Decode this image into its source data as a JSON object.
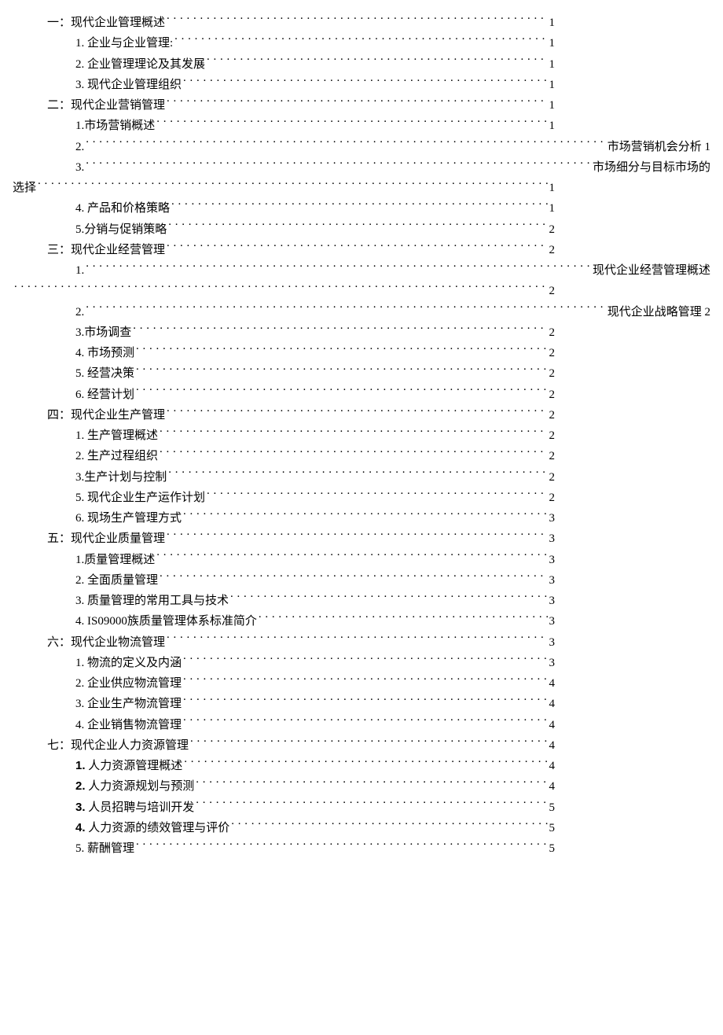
{
  "toc": [
    {
      "level": 0,
      "label": "一：现代企业管理概述",
      "page": "1",
      "spaceBeforePage": true
    },
    {
      "level": 1,
      "label": "1.  企业与企业管理:",
      "page": "1"
    },
    {
      "level": 1,
      "label": "2.  企业管理理论及其发展",
      "page": "1"
    },
    {
      "level": 1,
      "label": "3.  现代企业管理组织",
      "page": "1"
    },
    {
      "level": 0,
      "label": "二：现代企业营销管理",
      "page": "1"
    },
    {
      "level": 1,
      "label": "1.市场营销概述",
      "page": "1"
    },
    {
      "level": 1,
      "label": "2.",
      "trail": "市场营销机会分析 1"
    },
    {
      "level": 1,
      "label": "3.",
      "trail": "市场细分与目标市场的"
    },
    {
      "level": "cont2",
      "label": "选择",
      "page": "1"
    },
    {
      "level": 1,
      "label": "4. 产品和价格策略",
      "page": "1"
    },
    {
      "level": 1,
      "label": "5.分销与促销策略",
      "page": "2"
    },
    {
      "level": 0,
      "label": "三：现代企业经营管理",
      "page": "2"
    },
    {
      "level": 1,
      "label": "1.",
      "trail": "现代企业经营管理概述"
    },
    {
      "level": "cont2",
      "label": "",
      "page": "2"
    },
    {
      "level": 1,
      "label": "2.",
      "trail": "现代企业战略管理 2"
    },
    {
      "level": 1,
      "label": "3.市场调查",
      "page": "2"
    },
    {
      "level": 1,
      "label": "4. 市场预测",
      "page": "2"
    },
    {
      "level": 1,
      "label": "5. 经营决策",
      "page": "2"
    },
    {
      "level": 1,
      "label": "6. 经营计划",
      "page": "2"
    },
    {
      "level": 0,
      "label": "四：现代企业生产管理",
      "page": "2"
    },
    {
      "level": 1,
      "label": "1. 生产管理概述",
      "page": "2"
    },
    {
      "level": 1,
      "label": "2. 生产过程组织",
      "page": "2"
    },
    {
      "level": 1,
      "label": "3.生产计划与控制",
      "page": "2"
    },
    {
      "level": 1,
      "label": "5. 现代企业生产运作计划",
      "page": "2"
    },
    {
      "level": 1,
      "label": "6. 现场生产管理方式",
      "page": "3"
    },
    {
      "level": 0,
      "label": "五：现代企业质量管理",
      "page": "3"
    },
    {
      "level": 1,
      "label": "1.质量管理概述",
      "page": "3"
    },
    {
      "level": 1,
      "label": "2. 全面质量管理",
      "page": "3"
    },
    {
      "level": 1,
      "label": "3.  质量管理的常用工具与技术",
      "page": "3"
    },
    {
      "level": 1,
      "label": "4. IS09000族质量管理体系标准简介",
      "page": "3"
    },
    {
      "level": 0,
      "label": "六：现代企业物流管理",
      "page": "3"
    },
    {
      "level": 1,
      "label": "1.  物流的定义及内涵",
      "page": "3"
    },
    {
      "level": 1,
      "label": "2.  企业供应物流管理",
      "page": "4"
    },
    {
      "level": 1,
      "label": "3.  企业生产物流管理",
      "page": "4"
    },
    {
      "level": 1,
      "label": "4.  企业销售物流管理",
      "page": "4"
    },
    {
      "level": 0,
      "label": "七：现代企业人力资源管理",
      "page": "4"
    },
    {
      "level": 1,
      "label": "1. 人力资源管理概述",
      "page": "4",
      "boldNum": true
    },
    {
      "level": 1,
      "label": "2. 人力资源规划与预测",
      "page": "4",
      "boldNum": true
    },
    {
      "level": 1,
      "label": "3. 人员招聘与培训开发",
      "page": "5",
      "boldNum": true
    },
    {
      "level": 1,
      "label": "4. 人力资源的绩效管理与评价",
      "page": "5",
      "boldNum": true
    },
    {
      "level": 1,
      "label": "5.  薪酬管理",
      "page": "5"
    }
  ],
  "rightEdgeNormal": 690,
  "rightEdgeWide": 888
}
